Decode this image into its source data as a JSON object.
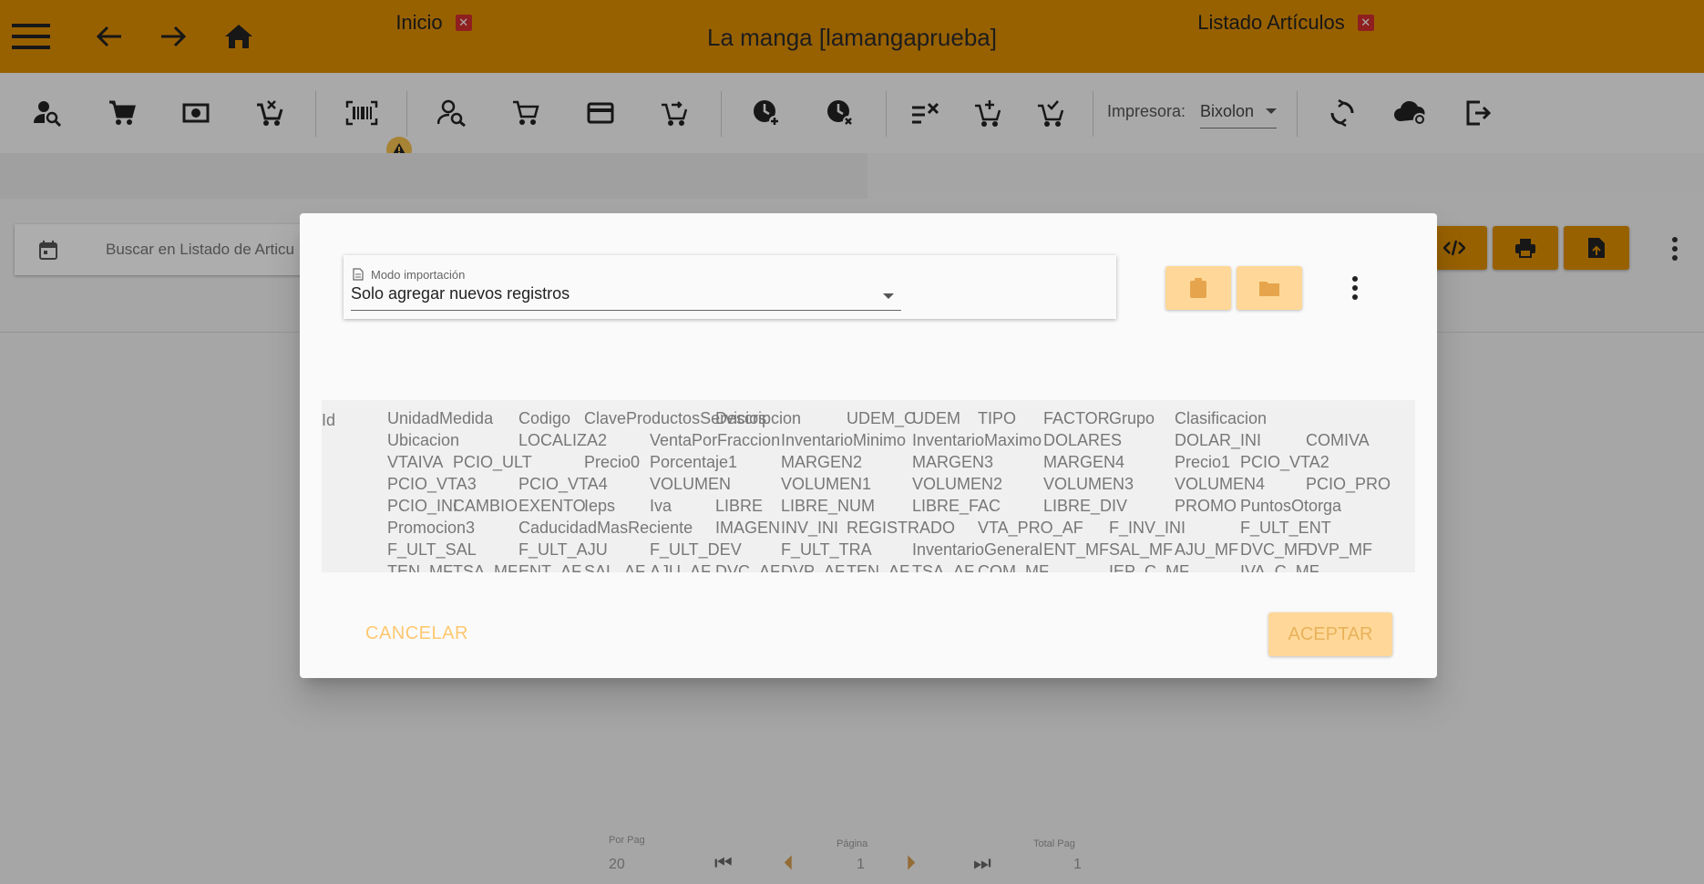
{
  "app": {
    "title": "La manga [lamangaprueba]"
  },
  "toolbar": {
    "printer_label": "Impresora:",
    "printer_value": "Bixolon",
    "icons": [
      "user-search-icon",
      "cart-icon",
      "money-icon",
      "cart-remove-icon",
      "barcode-icon",
      "user-search-2-icon",
      "cart-outline-icon",
      "credit-card-icon",
      "cart-arrow-icon",
      "clock-plus-icon",
      "clock-remove-icon",
      "checklist-remove-icon",
      "cart-plus-icon",
      "cart-check-icon",
      "sync-icon",
      "cloud-sync-icon",
      "logout-icon"
    ]
  },
  "tabs": [
    {
      "label": "Inicio"
    },
    {
      "label": "Listado Artículos"
    }
  ],
  "search": {
    "placeholder": "Buscar en Listado de Articu"
  },
  "dialog": {
    "mode_label": "Modo importación",
    "mode_value": "Solo agregar nuevos registros",
    "cancel_label": "CANCELAR",
    "accept_label": "ACEPTAR",
    "preview": {
      "first_col": "Id",
      "rows": [
        [
          "UnidadMedida",
          "Codigo",
          "ClaveProductosServicios",
          "Descripcion",
          "UDEM_C",
          "UDEM",
          "TIPO",
          "FACTOR",
          "Grupo",
          "Clasificacion"
        ],
        [
          "Ubicacion",
          "LOCALIZA2",
          "VentaPorFraccion",
          "InventarioMinimo",
          "InventarioMaximo",
          "DOLARES",
          "DOLAR_INI",
          "COMIVA"
        ],
        [
          "VTAIVA",
          "PCIO_ULT",
          "Precio0",
          "Porcentaje1",
          "MARGEN2",
          "MARGEN3",
          "MARGEN4",
          "Precio1",
          "PCIO_VTA2"
        ],
        [
          "PCIO_VTA3",
          "PCIO_VTA4",
          "VOLUMEN",
          "VOLUMEN1",
          "VOLUMEN2",
          "VOLUMEN3",
          "VOLUMEN4",
          "PCIO_PRO"
        ],
        [
          "PCIO_INI",
          "CAMBIO",
          "EXENTO",
          "Ieps",
          "Iva",
          "LIBRE",
          "LIBRE_NUM",
          "LIBRE_FAC",
          "LIBRE_DIV",
          "PROMO",
          "PuntosOtorga"
        ],
        [
          "Promocion3",
          "CaducidadMasReciente",
          "IMAGEN",
          "INV_INI",
          "REGISTRADO",
          "VTA_PRO_AF",
          "F_INV_INI",
          "F_ULT_ENT"
        ],
        [
          "F_ULT_SAL",
          "F_ULT_AJU",
          "F_ULT_DEV",
          "F_ULT_TRA",
          "InventarioGeneral",
          "ENT_MF",
          "SAL_MF",
          "AJU_MF",
          "DVC_MF",
          "DVP_MF"
        ],
        [
          "TEN_MF",
          "TSA_MF",
          "ENT_AF",
          "SAL_AF",
          "AJU_AF",
          "DVC_AF",
          "DVP_AF",
          "TEN_AF",
          "TSA_AF",
          "COM_MF",
          "IEP_C_MF",
          "IVA_C_MF"
        ]
      ]
    }
  },
  "pager": {
    "per_page_label": "Por Pag",
    "per_page": "20",
    "page_label": "Página",
    "page": "1",
    "total_label": "Total Pag",
    "total": "1"
  },
  "colors": {
    "primary": "#e08f00",
    "accent_light": "#ffd899",
    "danger": "#d32f2f"
  }
}
